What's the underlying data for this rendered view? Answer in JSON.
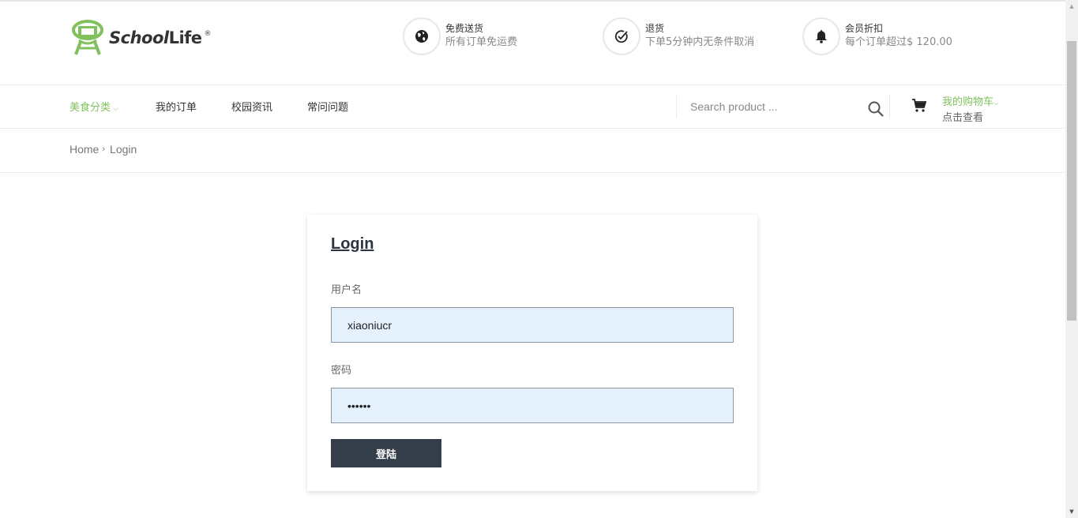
{
  "brand": {
    "school": "School",
    "life": "Life",
    "reg": "®",
    "accent_color": "#80c15e"
  },
  "features": [
    {
      "icon": "globe-icon",
      "title": "免费送货",
      "subtitle": "所有订单免运费"
    },
    {
      "icon": "check-circle-icon",
      "title": "退货",
      "subtitle": "下单5分钟内无条件取消"
    },
    {
      "icon": "bell-icon",
      "title": "会员折扣",
      "subtitle": "每个订单超过$ 120.00"
    }
  ],
  "nav": {
    "items": [
      {
        "label": "美食分类",
        "active": true,
        "has_dropdown": true
      },
      {
        "label": "我的订单"
      },
      {
        "label": "校园资讯"
      },
      {
        "label": "常问问题"
      }
    ],
    "search_placeholder": "Search product ...",
    "cart_label": "我的购物车",
    "cart_sub": "点击查看"
  },
  "breadcrumb": {
    "home": "Home",
    "current": "Login"
  },
  "login": {
    "title": "Login",
    "username_label": "用户名",
    "username_value": "xiaoniucr",
    "password_label": "密码",
    "password_value": "111111",
    "submit_label": "登陆",
    "button_color": "#343d4a",
    "field_bg": "#e5f0fd"
  }
}
